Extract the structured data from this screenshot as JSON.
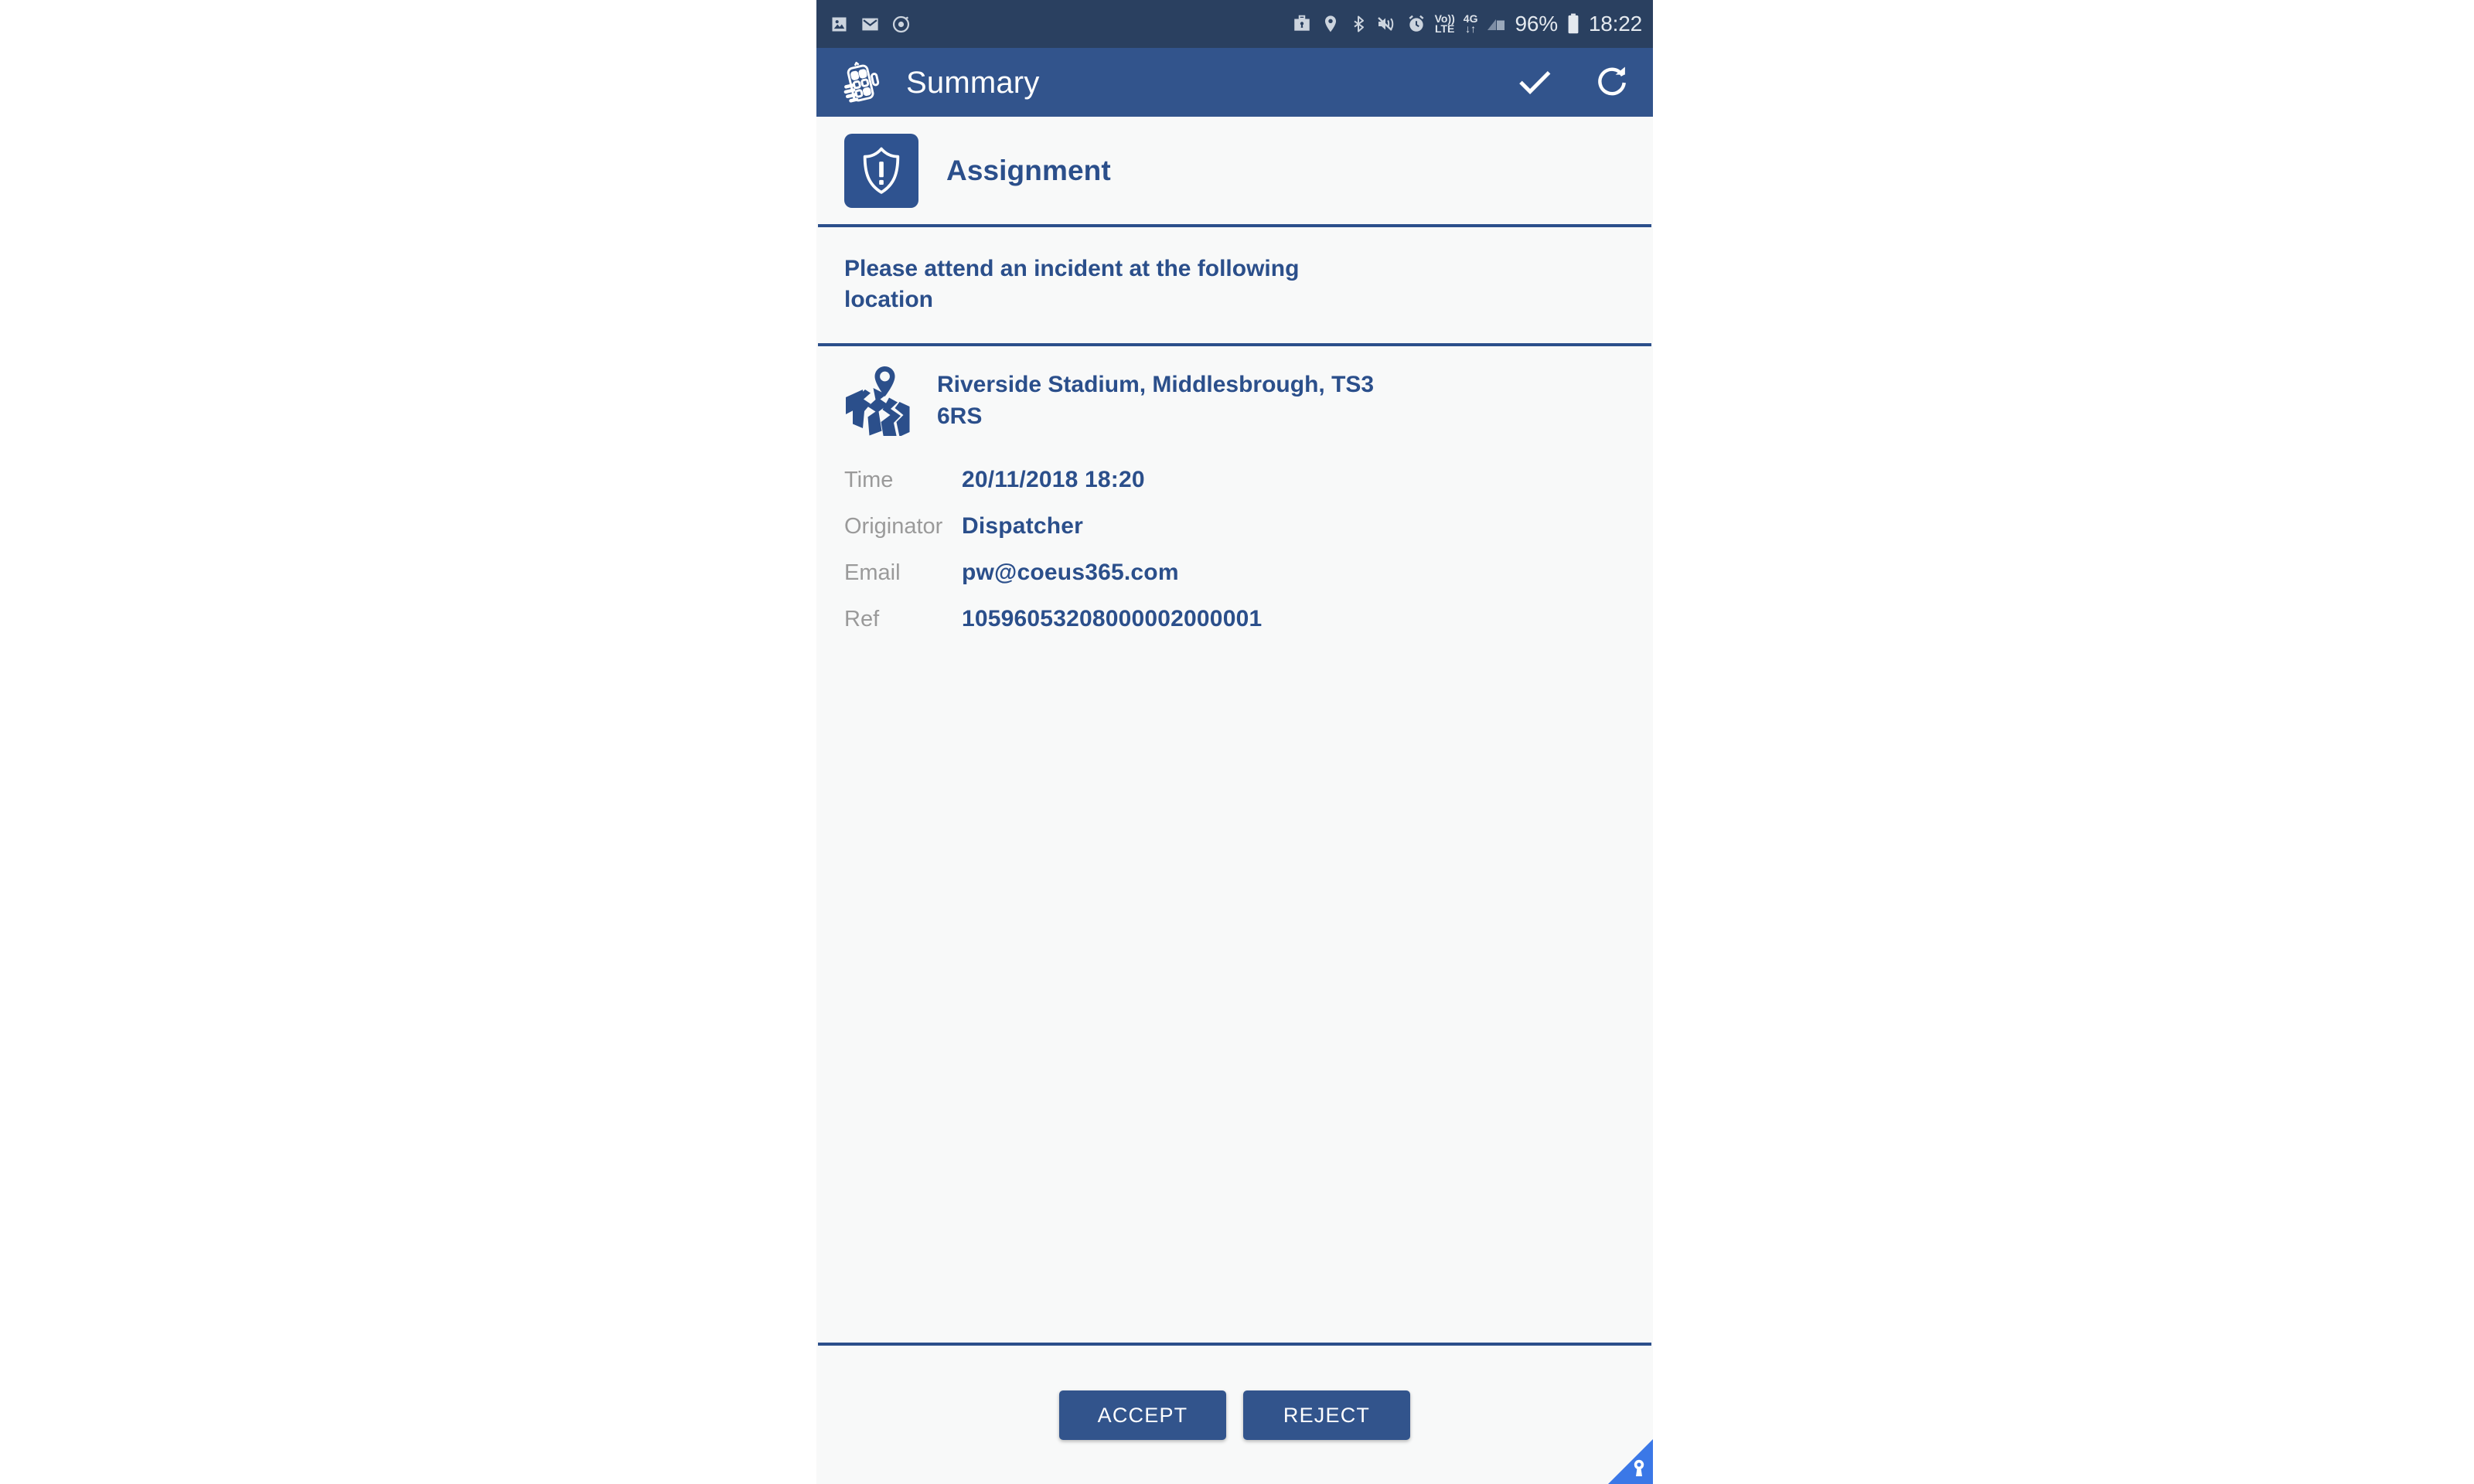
{
  "statusbar": {
    "left_icons": [
      "image-icon",
      "email-icon",
      "alarm-ring-icon"
    ],
    "right_icons": [
      "work-profile-briefcase-icon",
      "location-pin-icon",
      "bluetooth-icon",
      "mute-vibrate-icon",
      "alarm-clock-icon"
    ],
    "volte_top": "Vo))",
    "volte_bottom": "LTE",
    "network_top": "4G",
    "network_bottom": "↓↑",
    "battery_percent": "96%",
    "clock": "18:22"
  },
  "appbar": {
    "logo": "hand-holding-device-logo",
    "title": "Summary",
    "actions": [
      {
        "name": "confirm-check",
        "icon": "check-icon"
      },
      {
        "name": "refresh",
        "icon": "refresh-icon"
      }
    ]
  },
  "header": {
    "badge_icon": "shield-alert-icon",
    "title": "Assignment"
  },
  "instruction": {
    "text": "Please attend an incident at the following location"
  },
  "location": {
    "icon": "map-pin-icon",
    "address": "Riverside Stadium, Middlesbrough, TS3 6RS"
  },
  "details": [
    {
      "label": "Time",
      "value": "20/11/2018 18:20"
    },
    {
      "label": "Originator",
      "value": "Dispatcher"
    },
    {
      "label": "Email",
      "value": "pw@coeus365.com"
    },
    {
      "label": "Ref",
      "value": "10596053208000002000001"
    }
  ],
  "footer": {
    "accept_label": "ACCEPT",
    "reject_label": "REJECT"
  },
  "corner_badge": {
    "icon": "keyhole-icon"
  },
  "colors": {
    "statusbar_bg": "#2a4060",
    "appbar_bg": "#32548c",
    "accent_blue": "#2b4f8b",
    "content_bg": "#f8f9f9",
    "label_grey": "#9a9a9a",
    "corner_blue": "#3b78e7"
  }
}
